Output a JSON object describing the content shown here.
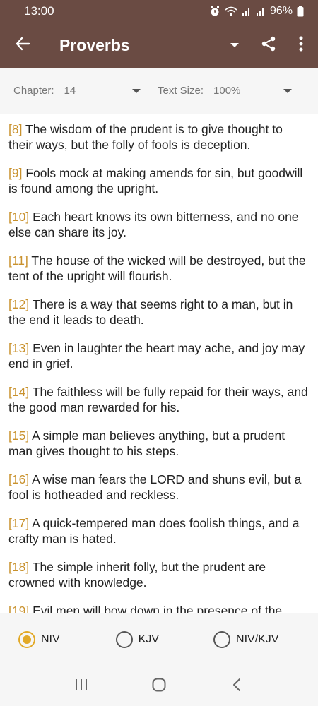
{
  "status_bar": {
    "time": "13:00",
    "battery": "96%",
    "icons": [
      "alarm-icon",
      "wifi-icon",
      "signal-icon",
      "signal-icon",
      "battery-icon"
    ]
  },
  "app_bar": {
    "title": "Proverbs",
    "icons": [
      "back-arrow-icon",
      "dropdown-caret-icon",
      "share-icon",
      "more-vert-icon"
    ]
  },
  "controls": {
    "chapter_label": "Chapter:",
    "chapter_value": "14",
    "text_size_label": "Text Size:",
    "text_size_value": "100%"
  },
  "verses": [
    {
      "num": "[8]",
      "text": " The wisdom of the prudent is to give thought to their ways, but the folly of fools is deception."
    },
    {
      "num": "[9]",
      "text": " Fools mock at making amends for sin, but goodwill is found among the upright."
    },
    {
      "num": "[10]",
      "text": " Each heart knows its own bitterness, and no one else can share its joy."
    },
    {
      "num": "[11]",
      "text": " The house of the wicked will be destroyed, but the tent of the upright will flourish."
    },
    {
      "num": "[12]",
      "text": " There is a way that seems right to a man, but in the end it leads to death."
    },
    {
      "num": "[13]",
      "text": " Even in laughter the heart may ache, and joy may end in grief."
    },
    {
      "num": "[14]",
      "text": " The faithless will be fully repaid for their ways, and the good man rewarded for his."
    },
    {
      "num": "[15]",
      "text": " A simple man believes anything, but a prudent man gives thought to his steps."
    },
    {
      "num": "[16]",
      "text": " A wise man fears the LORD and shuns evil, but a fool is hotheaded and reckless."
    },
    {
      "num": "[17]",
      "text": " A quick-tempered man does foolish things, and a crafty man is hated."
    },
    {
      "num": "[18]",
      "text": " The simple inherit folly, but the prudent are crowned with knowledge."
    },
    {
      "num": "[19]",
      "text": " Evil men will bow down in the presence of the"
    }
  ],
  "versions": {
    "options": [
      "NIV",
      "KJV",
      "NIV/KJV"
    ],
    "selected": "NIV"
  },
  "colors": {
    "app_bar": "#6a4b43",
    "verse_number": "#c9922e",
    "radio_selected": "#e2a928"
  },
  "system_nav": {
    "icons": [
      "recent-apps-icon",
      "home-icon",
      "back-icon"
    ]
  }
}
